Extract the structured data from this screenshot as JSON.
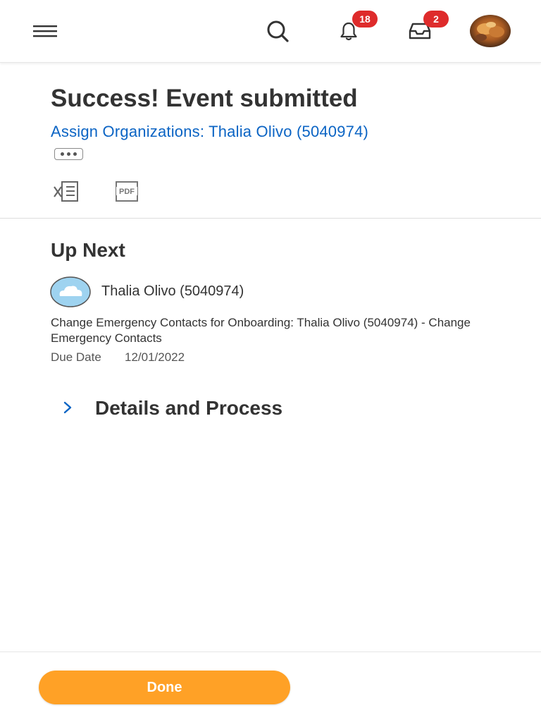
{
  "header": {
    "menu_icon": "hamburger-menu-icon",
    "search_icon": "search-icon",
    "notifications": {
      "icon": "bell-icon",
      "count": "18"
    },
    "inbox": {
      "icon": "inbox-tray-icon",
      "count": "2"
    },
    "avatar_icon": "user-avatar-photo"
  },
  "main": {
    "title": "Success! Event submitted",
    "event_link": "Assign Organizations: Thalia Olivo (5040974)",
    "more_icon": "more-ellipsis-icon",
    "export_excel_icon": "excel-export-icon",
    "export_pdf_icon": "pdf-export-icon"
  },
  "up_next": {
    "heading": "Up Next",
    "avatar_icon": "cloud-avatar-icon",
    "person": "Thalia Olivo (5040974)",
    "task": "Change Emergency Contacts for Onboarding: Thalia Olivo (5040974) - Change Emergency Contacts",
    "due_label": "Due Date",
    "due_value": "12/01/2022"
  },
  "details": {
    "label": "Details and Process",
    "chevron_icon": "chevron-right-icon"
  },
  "footer": {
    "done_label": "Done"
  },
  "colors": {
    "link": "#0b64c4",
    "badge": "#de2b2b",
    "primary_button": "#ffa126",
    "text": "#333333"
  }
}
